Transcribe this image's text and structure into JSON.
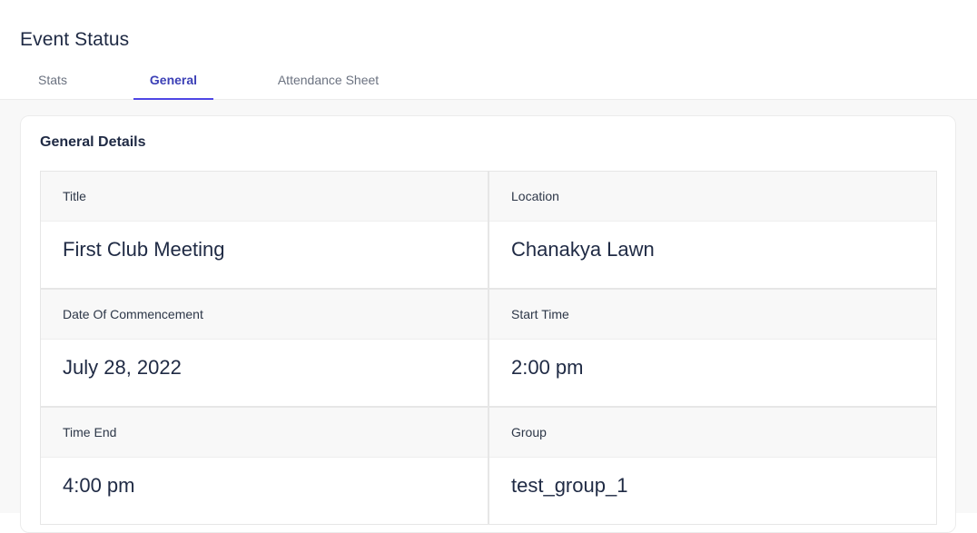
{
  "page": {
    "title": "Event Status"
  },
  "tabs": [
    {
      "label": "Stats",
      "active": false
    },
    {
      "label": "General",
      "active": true
    },
    {
      "label": "Attendance Sheet",
      "active": false
    }
  ],
  "general": {
    "heading": "General Details",
    "fields": [
      {
        "label": "Title",
        "value": "First Club Meeting"
      },
      {
        "label": "Location",
        "value": "Chanakya Lawn"
      },
      {
        "label": "Date Of Commencement",
        "value": "July 28, 2022"
      },
      {
        "label": "Start Time",
        "value": "2:00 pm"
      },
      {
        "label": "Time End",
        "value": "4:00 pm"
      },
      {
        "label": "Group",
        "value": "test_group_1"
      }
    ]
  },
  "colors": {
    "accent": "#4f46e5",
    "text": "#1f2a44",
    "muted": "#6b7280"
  }
}
